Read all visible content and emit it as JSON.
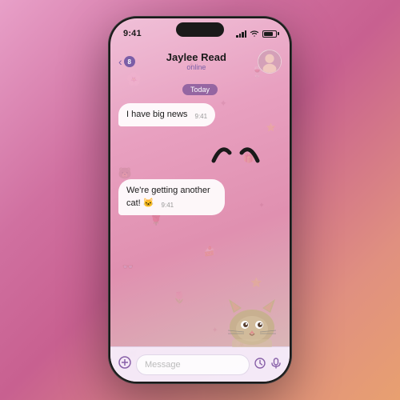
{
  "phone": {
    "status_bar": {
      "time": "9:41",
      "signal_bars": [
        3,
        5,
        7,
        9,
        11
      ],
      "battery_level": "80"
    },
    "header": {
      "back_label": "‹",
      "badge_count": "8",
      "contact_name": "Jaylee Read",
      "contact_status": "online",
      "avatar_emoji": "👩"
    },
    "date_label": "Today",
    "messages": [
      {
        "id": "msg1",
        "text": "I have big news",
        "time": "9:41",
        "type": "incoming"
      },
      {
        "id": "msg2",
        "text": "We're getting another cat! 🐱",
        "time": "9:41",
        "type": "incoming"
      }
    ],
    "eyebrows": "ᵕ̈",
    "input_bar": {
      "placeholder": "Message",
      "attach_icon": "📎"
    }
  }
}
